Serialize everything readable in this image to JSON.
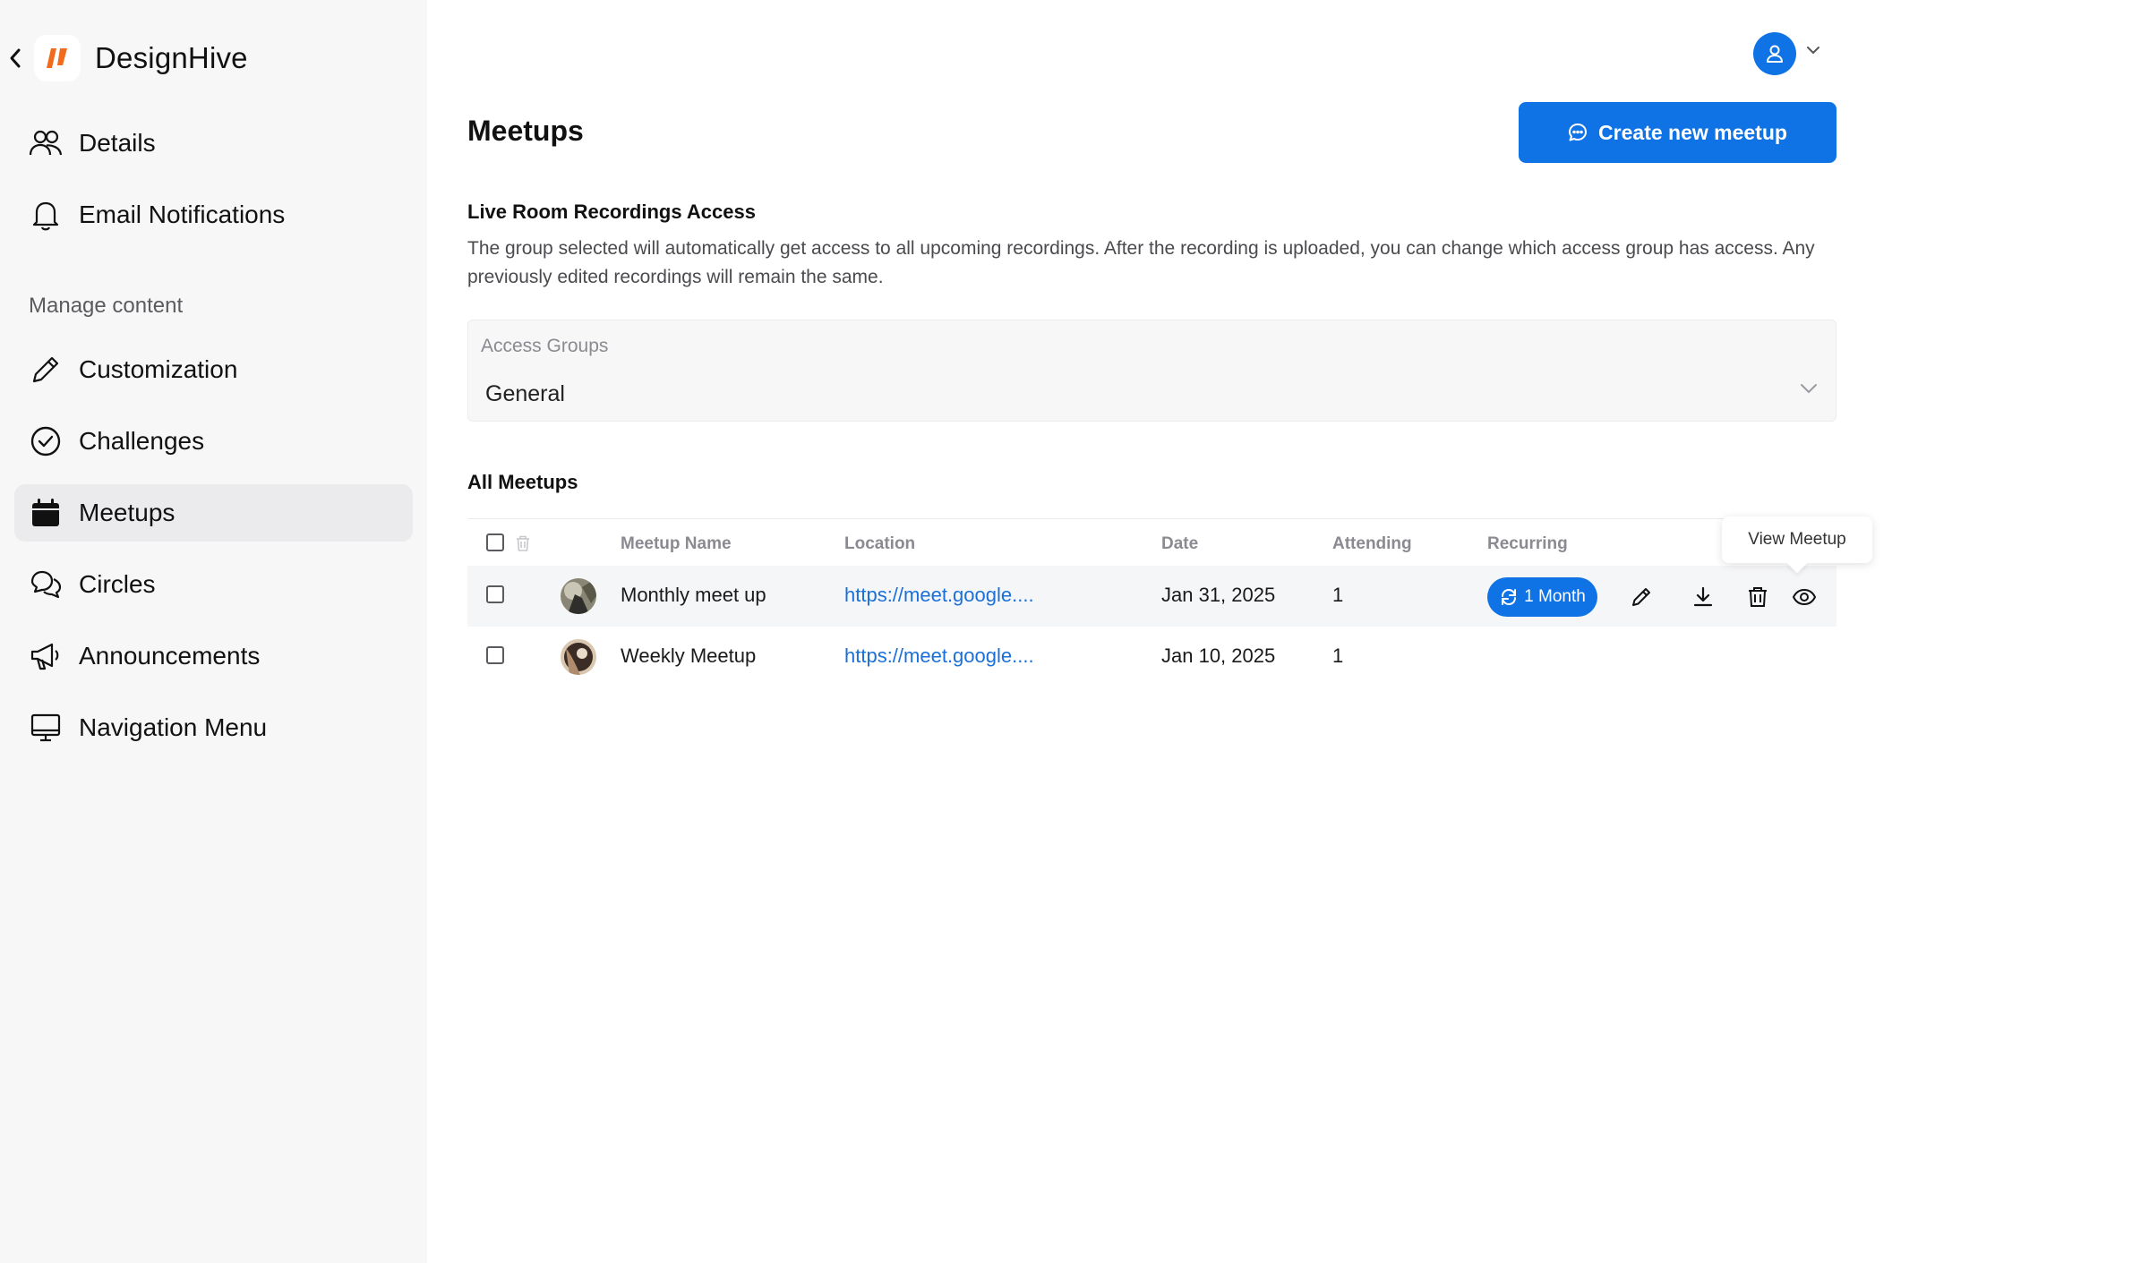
{
  "brand": {
    "name": "DesignHive"
  },
  "sidebar": {
    "items": [
      {
        "label": "Details",
        "icon": "users-icon"
      },
      {
        "label": "Email Notifications",
        "icon": "bell-icon"
      }
    ],
    "section_title": "Manage content",
    "content_items": [
      {
        "label": "Customization",
        "icon": "pencil-icon"
      },
      {
        "label": "Challenges",
        "icon": "check-circle-icon"
      },
      {
        "label": "Meetups",
        "icon": "calendar-icon",
        "active": true
      },
      {
        "label": "Circles",
        "icon": "chat-bubbles-icon"
      },
      {
        "label": "Announcements",
        "icon": "megaphone-icon"
      },
      {
        "label": "Navigation Menu",
        "icon": "monitor-icon"
      }
    ]
  },
  "header": {
    "title": "Meetups",
    "create_button": "Create new meetup"
  },
  "recordings": {
    "title": "Live Room Recordings Access",
    "description": "The group selected will automatically get access to all upcoming recordings. After the recording is uploaded, you can change which access group has access. Any previously edited recordings will remain the same.",
    "access_label": "Access Groups",
    "access_value": "General"
  },
  "meetups": {
    "title": "All Meetups",
    "columns": {
      "name": "Meetup Name",
      "location": "Location",
      "date": "Date",
      "attending": "Attending",
      "recurring": "Recurring"
    },
    "rows": [
      {
        "name": "Monthly meet up",
        "location": "https://meet.google....",
        "date": "Jan 31, 2025",
        "attending": "1",
        "recurring": "1 Month"
      },
      {
        "name": "Weekly Meetup",
        "location": "https://meet.google....",
        "date": "Jan 10, 2025",
        "attending": "1",
        "recurring": ""
      }
    ],
    "tooltip": "View Meetup"
  },
  "colors": {
    "accent": "#0f73e6",
    "link": "#1a6fd8",
    "sidebar_bg": "#f7f7f8",
    "logo_orange": "#f26b1d"
  }
}
